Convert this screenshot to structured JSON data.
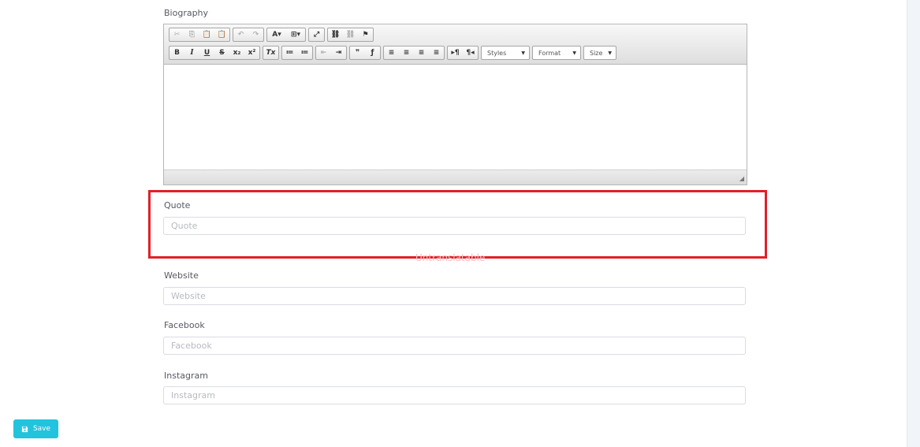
{
  "biography": {
    "label": "Biography",
    "toolbar": {
      "row1": [
        [
          "✂",
          "⎘",
          "📋",
          "📋"
        ],
        [
          "↶",
          "↷"
        ],
        [
          "A▾",
          "⊞▾"
        ],
        [
          "⤢"
        ],
        [
          "⛓",
          "⛓",
          "⚑"
        ]
      ],
      "row2": [
        [
          "B",
          "I",
          "U",
          "S",
          "x₂",
          "x²"
        ],
        [
          "Tx"
        ],
        [
          "≔",
          "≔"
        ],
        [
          "⇤",
          "⇥"
        ],
        [
          "❞",
          "ƒ"
        ],
        [
          "≡",
          "≡",
          "≡",
          "≡"
        ],
        [
          "▸¶",
          "¶◂"
        ]
      ],
      "styles_label": "Styles",
      "format_label": "Format",
      "size_label": "Size"
    }
  },
  "quote": {
    "label": "Quote",
    "placeholder": "Quote"
  },
  "untranslatable_text": "Untranslatable",
  "website": {
    "label": "Website",
    "placeholder": "Website"
  },
  "facebook": {
    "label": "Facebook",
    "placeholder": "Facebook"
  },
  "instagram": {
    "label": "Instagram",
    "placeholder": "Instagram"
  },
  "save_label": "Save",
  "colors": {
    "accent": "#22c3dd",
    "highlight": "#e02028"
  }
}
